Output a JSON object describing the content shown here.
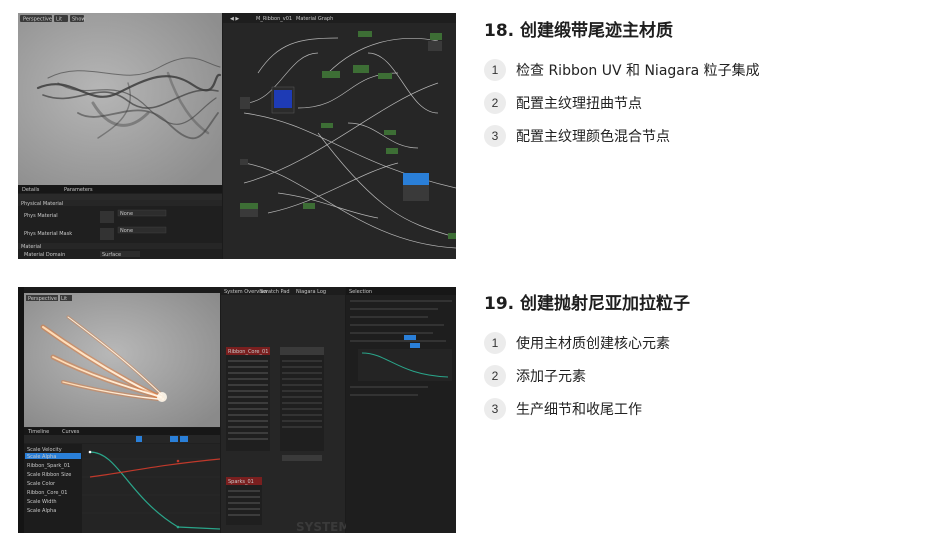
{
  "sections": [
    {
      "title": "18. 创建缎带尾迹主材质",
      "steps": [
        {
          "num": "1",
          "text": "检查 Ribbon UV 和 Niagara 粒子集成"
        },
        {
          "num": "2",
          "text": "配置主纹理扭曲节点"
        },
        {
          "num": "3",
          "text": "配置主纹理颜色混合节点"
        }
      ]
    },
    {
      "title": "19. 创建抛射尼亚加拉粒子",
      "steps": [
        {
          "num": "1",
          "text": "使用主材质创建核心元素"
        },
        {
          "num": "2",
          "text": "添加子元素"
        },
        {
          "num": "3",
          "text": "生产细节和收尾工作"
        }
      ]
    }
  ],
  "shot1": {
    "viewport_mode": "Perspective",
    "lit_mode": "Lit",
    "show_label": "Show",
    "graph_tab": "M_Ribbon_v01",
    "graph_breadcrumb": "Material Graph",
    "details_tab": "Details",
    "parameters_tab": "Parameters",
    "category_physical": "Physical Material",
    "row1_label": "Phys Material",
    "row2_label": "Phys Material Mask",
    "none_value": "None",
    "category_material": "Material",
    "material_domain_label": "Material Domain",
    "material_domain_value": "Surface"
  },
  "shot2": {
    "viewport_mode": "Perspective",
    "lit_mode": "Lit",
    "timeline_tab": "Timeline",
    "curves_tab": "Curves",
    "system_overview_tab": "System Overview",
    "scratch_pad_tab": "Scratch Pad",
    "niagara_log_tab": "Niagara Log",
    "selection_tab": "Selection",
    "emitter_header": "Ribbon_Core_01",
    "emitter2_header": "Sparks_01",
    "watermark": "SYSTEM",
    "curve_items": [
      "Scale Velocity",
      "Scale Alpha",
      "Ribbon_Spark_01",
      "Scale Ribbon Size",
      "Scale Color",
      "Ribbon_Core_01",
      "Scale Width",
      "Scale Alpha"
    ]
  },
  "colors": {
    "editor_bg": "#1b1b1b",
    "graph_bg": "#262626",
    "accent_blue": "#2a7fd8",
    "node_green": "#3d6e35",
    "node_red": "#7a1f1f",
    "curve_green": "#2aa58a",
    "curve_red": "#c0392b"
  }
}
